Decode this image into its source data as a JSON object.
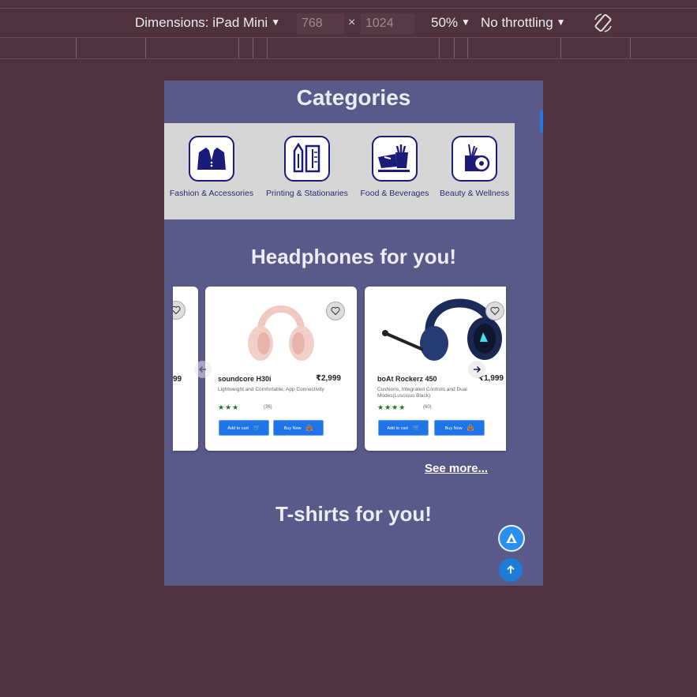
{
  "devtools": {
    "dimensions_label": "Dimensions: iPad Mini",
    "width": "768",
    "times": "×",
    "height": "1024",
    "zoom": "50%",
    "throttling": "No throttling",
    "rotate_icon": "rotate-icon"
  },
  "page": {
    "categories_title": "Categories",
    "categories": [
      {
        "label": "Fashion & Accessories",
        "icon": "suit-icon"
      },
      {
        "label": "Printing & Stationaries",
        "icon": "stationery-icon"
      },
      {
        "label": "Food & Beverages",
        "icon": "food-icon"
      },
      {
        "label": "Beauty & Wellness",
        "icon": "beauty-icon"
      }
    ],
    "headphones_title": "Headphones for you!",
    "products": [
      {
        "price_partial": "99"
      },
      {
        "name": "soundcore H30i",
        "price": "₹2,999",
        "description": "Lightweight and Comfortable, App Connectivity",
        "stars": "★★★",
        "reviews": "(36)",
        "add_to_cart": "Add to cart",
        "buy_now": "Buy Now"
      },
      {
        "name": "boAt Rockerz 450",
        "price": "₹1,999",
        "description": "Cushions, Integrated Controls and Dual Modes(Luscious Black)",
        "stars": "★★★★",
        "reviews": "(60)",
        "add_to_cart": "Add to cart",
        "buy_now": "Buy Now"
      }
    ],
    "see_more": "See more...",
    "tshirts_title": "T-shirts for you!"
  },
  "colors": {
    "page_background": "#5a5a8a",
    "accent_blue": "#1f74e8",
    "devtools_background": "#4f323d"
  }
}
